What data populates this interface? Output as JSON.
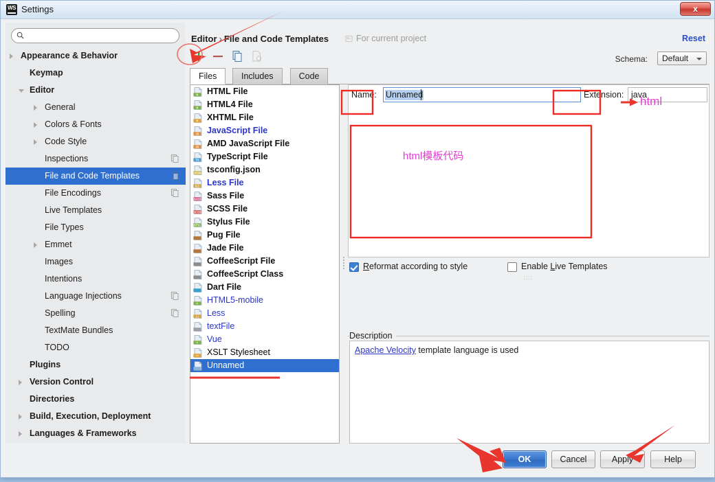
{
  "window": {
    "title": "Settings",
    "app_icon": "webstorm-icon",
    "close_label": "x"
  },
  "sidebar": {
    "search": {
      "value": "",
      "placeholder": "",
      "icon": "search-icon"
    },
    "items": [
      {
        "label": "Appearance & Behavior",
        "indent": 22,
        "bold": true,
        "arrow": "right",
        "selected": false,
        "copy": false
      },
      {
        "label": "Keymap",
        "indent": 35,
        "bold": true,
        "arrow": "none",
        "selected": false,
        "copy": false
      },
      {
        "label": "Editor",
        "indent": 35,
        "bold": true,
        "arrow": "down",
        "selected": false,
        "copy": false
      },
      {
        "label": "General",
        "indent": 57,
        "bold": false,
        "arrow": "right",
        "selected": false,
        "copy": false
      },
      {
        "label": "Colors & Fonts",
        "indent": 57,
        "bold": false,
        "arrow": "right",
        "selected": false,
        "copy": false
      },
      {
        "label": "Code Style",
        "indent": 57,
        "bold": false,
        "arrow": "right",
        "selected": false,
        "copy": false
      },
      {
        "label": "Inspections",
        "indent": 57,
        "bold": false,
        "arrow": "none",
        "selected": false,
        "copy": true
      },
      {
        "label": "File and Code Templates",
        "indent": 57,
        "bold": false,
        "arrow": "none",
        "selected": true,
        "copy": true
      },
      {
        "label": "File Encodings",
        "indent": 57,
        "bold": false,
        "arrow": "none",
        "selected": false,
        "copy": true
      },
      {
        "label": "Live Templates",
        "indent": 57,
        "bold": false,
        "arrow": "none",
        "selected": false,
        "copy": false
      },
      {
        "label": "File Types",
        "indent": 57,
        "bold": false,
        "arrow": "none",
        "selected": false,
        "copy": false
      },
      {
        "label": "Emmet",
        "indent": 57,
        "bold": false,
        "arrow": "right",
        "selected": false,
        "copy": false
      },
      {
        "label": "Images",
        "indent": 57,
        "bold": false,
        "arrow": "none",
        "selected": false,
        "copy": false
      },
      {
        "label": "Intentions",
        "indent": 57,
        "bold": false,
        "arrow": "none",
        "selected": false,
        "copy": false
      },
      {
        "label": "Language Injections",
        "indent": 57,
        "bold": false,
        "arrow": "none",
        "selected": false,
        "copy": true
      },
      {
        "label": "Spelling",
        "indent": 57,
        "bold": false,
        "arrow": "none",
        "selected": false,
        "copy": true
      },
      {
        "label": "TextMate Bundles",
        "indent": 57,
        "bold": false,
        "arrow": "none",
        "selected": false,
        "copy": false
      },
      {
        "label": "TODO",
        "indent": 57,
        "bold": false,
        "arrow": "none",
        "selected": false,
        "copy": false
      },
      {
        "label": "Plugins",
        "indent": 35,
        "bold": true,
        "arrow": "none",
        "selected": false,
        "copy": false
      },
      {
        "label": "Version Control",
        "indent": 35,
        "bold": true,
        "arrow": "right",
        "selected": false,
        "copy": false
      },
      {
        "label": "Directories",
        "indent": 35,
        "bold": true,
        "arrow": "none",
        "selected": false,
        "copy": false
      },
      {
        "label": "Build, Execution, Deployment",
        "indent": 35,
        "bold": true,
        "arrow": "right",
        "selected": false,
        "copy": false
      },
      {
        "label": "Languages & Frameworks",
        "indent": 35,
        "bold": true,
        "arrow": "right",
        "selected": false,
        "copy": false
      }
    ]
  },
  "main": {
    "breadcrumb_parent": "Editor",
    "breadcrumb_sep": "›",
    "breadcrumb_current": "File and Code Templates",
    "scope_label": "For current project",
    "scope_icon": "project-scope-icon",
    "reset_label": "Reset",
    "schema_label": "Schema:",
    "schema_value": "Default",
    "toolbar": [
      {
        "name": "add-button",
        "glyph": "+",
        "enabled": true
      },
      {
        "name": "remove-button",
        "glyph": "−",
        "enabled": true
      },
      {
        "name": "copy-button",
        "glyph": "copy-icon",
        "enabled": true
      },
      {
        "name": "associate-button",
        "glyph": "associate-icon",
        "enabled": false
      }
    ],
    "tabs": [
      {
        "label": "Files",
        "active": true
      },
      {
        "label": "Includes",
        "active": false
      },
      {
        "label": "Code",
        "active": false
      }
    ],
    "templates": [
      {
        "label": "HTML File",
        "bold": true,
        "blue": false,
        "selected": false,
        "icon": "html-file-icon",
        "badge": "H",
        "badge_color": "#7fb04d"
      },
      {
        "label": "HTML4 File",
        "bold": true,
        "blue": false,
        "selected": false,
        "icon": "html-file-icon",
        "badge": "H",
        "badge_color": "#7fb04d"
      },
      {
        "label": "XHTML File",
        "bold": true,
        "blue": false,
        "selected": false,
        "icon": "xhtml-file-icon",
        "badge": "H",
        "badge_color": "#e0a33a"
      },
      {
        "label": "JavaScript File",
        "bold": true,
        "blue": true,
        "selected": false,
        "icon": "js-file-icon",
        "badge": "JS",
        "badge_color": "#e08f3a"
      },
      {
        "label": "AMD JavaScript File",
        "bold": true,
        "blue": false,
        "selected": false,
        "icon": "js-file-icon",
        "badge": "JS",
        "badge_color": "#e08f3a"
      },
      {
        "label": "TypeScript File",
        "bold": true,
        "blue": false,
        "selected": false,
        "icon": "ts-file-icon",
        "badge": "TS",
        "badge_color": "#4d9bcf"
      },
      {
        "label": "tsconfig.json",
        "bold": true,
        "blue": false,
        "selected": false,
        "icon": "json-file-icon",
        "badge": "JSON",
        "badge_color": "#c9b23a"
      },
      {
        "label": "Less File",
        "bold": true,
        "blue": true,
        "selected": false,
        "icon": "less-file-icon",
        "badge": "{L}",
        "badge_color": "#d8a33a"
      },
      {
        "label": "Sass File",
        "bold": true,
        "blue": false,
        "selected": false,
        "icon": "sass-file-icon",
        "badge": "SASS",
        "badge_color": "#cf4d7f"
      },
      {
        "label": "SCSS File",
        "bold": true,
        "blue": false,
        "selected": false,
        "icon": "scss-file-icon",
        "badge": "SCSS",
        "badge_color": "#cf4d4d"
      },
      {
        "label": "Stylus File",
        "bold": true,
        "blue": false,
        "selected": false,
        "icon": "stylus-file-icon",
        "badge": "STYL",
        "badge_color": "#7fb04d"
      },
      {
        "label": "Pug File",
        "bold": true,
        "blue": false,
        "selected": false,
        "icon": "pug-file-icon",
        "badge": "",
        "badge_color": "#b5763a"
      },
      {
        "label": "Jade File",
        "bold": true,
        "blue": false,
        "selected": false,
        "icon": "jade-file-icon",
        "badge": "",
        "badge_color": "#b5763a"
      },
      {
        "label": "CoffeeScript File",
        "bold": true,
        "blue": false,
        "selected": false,
        "icon": "coffee-file-icon",
        "badge": "",
        "badge_color": "#8d8d8d"
      },
      {
        "label": "CoffeeScript Class",
        "bold": true,
        "blue": false,
        "selected": false,
        "icon": "coffee-file-icon",
        "badge": "",
        "badge_color": "#8d8d8d"
      },
      {
        "label": "Dart File",
        "bold": true,
        "blue": false,
        "selected": false,
        "icon": "dart-file-icon",
        "badge": "",
        "badge_color": "#3aa0cf"
      },
      {
        "label": "HTML5-mobile",
        "bold": false,
        "blue": true,
        "selected": false,
        "icon": "html-file-icon",
        "badge": "H",
        "badge_color": "#7fb04d"
      },
      {
        "label": "Less",
        "bold": false,
        "blue": true,
        "selected": false,
        "icon": "less-file-icon",
        "badge": "{L}",
        "badge_color": "#d8a33a"
      },
      {
        "label": "textFile",
        "bold": false,
        "blue": true,
        "selected": false,
        "icon": "text-file-icon",
        "badge": "",
        "badge_color": "#9aa0a6"
      },
      {
        "label": "Vue",
        "bold": false,
        "blue": true,
        "selected": false,
        "icon": "vue-file-icon",
        "badge": "H",
        "badge_color": "#7fb04d"
      },
      {
        "label": "XSLT Stylesheet",
        "bold": false,
        "blue": false,
        "selected": false,
        "icon": "xslt-file-icon",
        "badge": "<>",
        "badge_color": "#e0a33a"
      },
      {
        "label": "Unnamed",
        "bold": false,
        "blue": true,
        "selected": true,
        "icon": "unnamed-file-icon",
        "badge": "",
        "badge_color": "#8ab4dd"
      }
    ],
    "name_label": "Name:",
    "name_value": "Unnamed",
    "extension_label": "Extension:",
    "extension_value": "java",
    "code_text": "",
    "reformat_label_pre": "R",
    "reformat_label_post": "eformat according to style",
    "reformat_checked": true,
    "live_templates_label_pre": "Enable ",
    "live_templates_label_mid": "L",
    "live_templates_label_post": "ive Templates",
    "live_templates_checked": false,
    "live_templates_hint": "::::",
    "description_title": "Description",
    "description_link": "Apache Velocity",
    "description_rest": " template language is used"
  },
  "footer": {
    "ok": "OK",
    "cancel": "Cancel",
    "apply": "Apply",
    "help": "Help"
  },
  "annotations": {
    "extension_note": "html",
    "code_note": "html模板代码",
    "highlight_color": "#ec2b25",
    "note_color": "#e23fd0"
  }
}
